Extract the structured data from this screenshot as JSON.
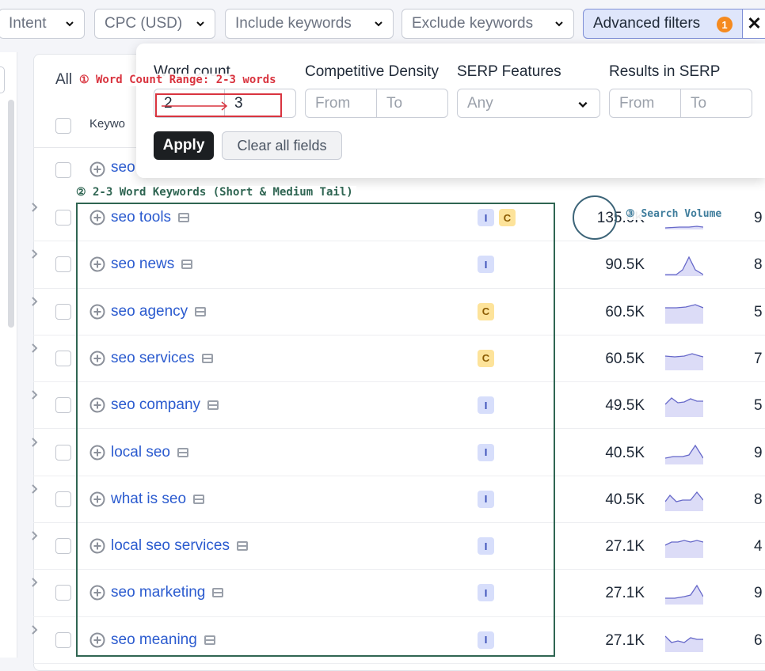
{
  "filters": {
    "intent": "Intent",
    "cpc": "CPC (USD)",
    "include": "Include keywords",
    "exclude": "Exclude keywords",
    "advanced": "Advanced filters",
    "advanced_count": "1",
    "close": "✕"
  },
  "tabs": {
    "all": "All"
  },
  "table": {
    "header_keyword": "Keywo"
  },
  "popup": {
    "word_count_label": "Word count",
    "word_count_from": "2",
    "word_count_to": "3",
    "density_label": "Competitive Density",
    "density_from": "From",
    "density_to": "To",
    "serp_label": "SERP Features",
    "serp_value": "Any",
    "results_label": "Results in SERP",
    "results_from": "From",
    "results_to": "To",
    "apply": "Apply",
    "clear": "Clear all fields"
  },
  "partial_row": {
    "keyword": "seo"
  },
  "rows": [
    {
      "keyword": "seo tools",
      "intents": [
        "I",
        "C"
      ],
      "volume": "135.0K",
      "tail": "9"
    },
    {
      "keyword": "seo news",
      "intents": [
        "I"
      ],
      "volume": "90.5K",
      "tail": "8"
    },
    {
      "keyword": "seo agency",
      "intents": [
        "C"
      ],
      "volume": "60.5K",
      "tail": "5"
    },
    {
      "keyword": "seo services",
      "intents": [
        "C"
      ],
      "volume": "60.5K",
      "tail": "7"
    },
    {
      "keyword": "seo company",
      "intents": [
        "I"
      ],
      "volume": "49.5K",
      "tail": "5"
    },
    {
      "keyword": "local seo",
      "intents": [
        "I"
      ],
      "volume": "40.5K",
      "tail": "9"
    },
    {
      "keyword": "what is seo",
      "intents": [
        "I"
      ],
      "volume": "40.5K",
      "tail": "8"
    },
    {
      "keyword": "local seo services",
      "intents": [
        "I"
      ],
      "volume": "27.1K",
      "tail": "4"
    },
    {
      "keyword": "seo marketing",
      "intents": [
        "I"
      ],
      "volume": "27.1K",
      "tail": "9"
    },
    {
      "keyword": "seo meaning",
      "intents": [
        "I"
      ],
      "volume": "27.1K",
      "tail": "6"
    }
  ],
  "annotations": {
    "a1": "① Word Count Range: 2-3 words",
    "a2": "② 2-3 Word Keywords (Short & Medium Tail)",
    "a3": "③ Search Volume"
  },
  "colors": {
    "ann1": "#d9343f",
    "ann2": "#2f6552",
    "ann3": "#3c6478",
    "link": "#2b5bcf",
    "spark_fill": "#dcdcf7",
    "spark_line": "#6668c9"
  }
}
